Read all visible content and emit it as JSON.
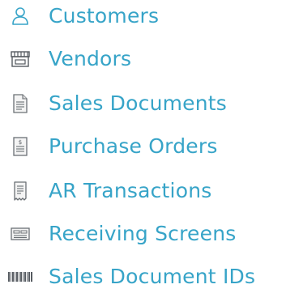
{
  "accent_color": "#37a4c8",
  "icon_color": "#6b7075",
  "nav": {
    "items": [
      {
        "label": "Customers",
        "icon": "user-icon"
      },
      {
        "label": "Vendors",
        "icon": "storefront-icon"
      },
      {
        "label": "Sales Documents",
        "icon": "document-icon"
      },
      {
        "label": "Purchase Orders",
        "icon": "invoice-icon"
      },
      {
        "label": "AR Transactions",
        "icon": "receipt-icon"
      },
      {
        "label": "Receiving Screens",
        "icon": "keyboard-icon"
      },
      {
        "label": "Sales Document IDs",
        "icon": "barcode-icon"
      }
    ]
  }
}
